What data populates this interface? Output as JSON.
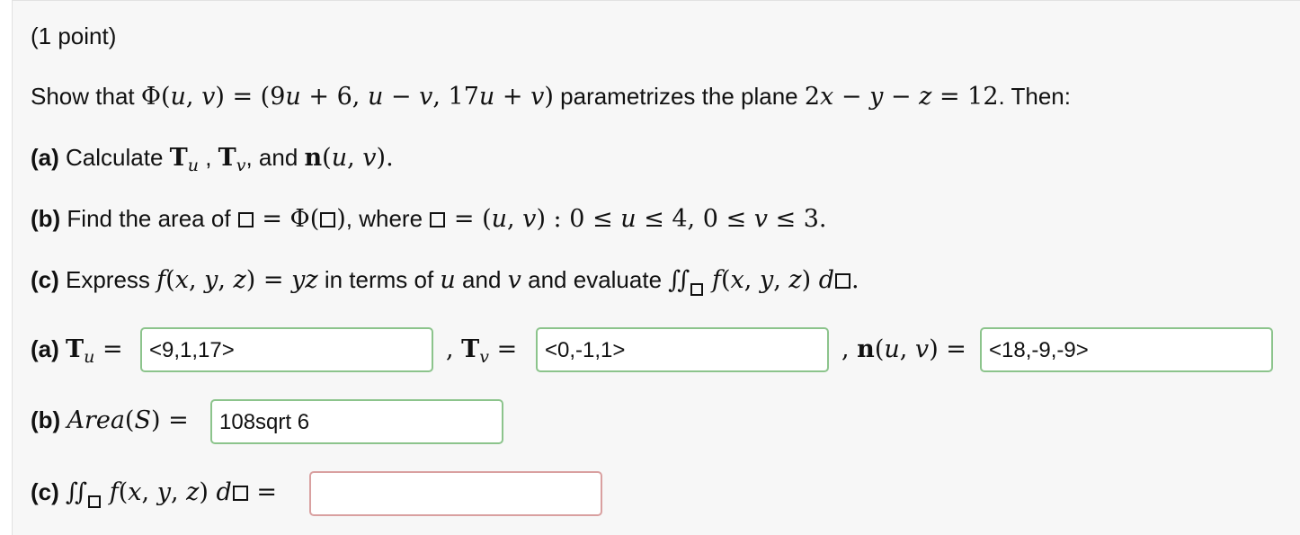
{
  "points": "(1 point)",
  "intro": {
    "prefix": "Show that ",
    "words1": " parametrizes the plane ",
    "suffix": ". Then:"
  },
  "part_a": {
    "label": "(a)",
    "text": " Calculate ",
    "sep1": " , ",
    "sep2": ", and "
  },
  "part_b": {
    "label": "(b)",
    "text1": " Find the area of ",
    "text2": ", where ",
    "domain": "(u, v) : 0 ≤ u ≤ 4, 0 ≤ v ≤ 3."
  },
  "part_c": {
    "label": "(c)",
    "text1": " Express ",
    "text2": " in terms of ",
    "text3": " and ",
    "text4": " and evaluate "
  },
  "answers": {
    "a_label": "(a)",
    "Tu_value": "<9,1,17>",
    "Tv_value": "<0,-1,1>",
    "n_value": "<18,-9,-9>",
    "b_label": "(b)",
    "area_value": "108sqrt 6",
    "c_label": "(c)",
    "integral_value": ""
  },
  "input_status": {
    "Tu": "correct",
    "Tv": "correct",
    "n": "correct",
    "area": "correct",
    "integral": "incorrect"
  },
  "colors": {
    "correct_border": "#8cc48c",
    "incorrect_border": "#d9a0a0"
  }
}
